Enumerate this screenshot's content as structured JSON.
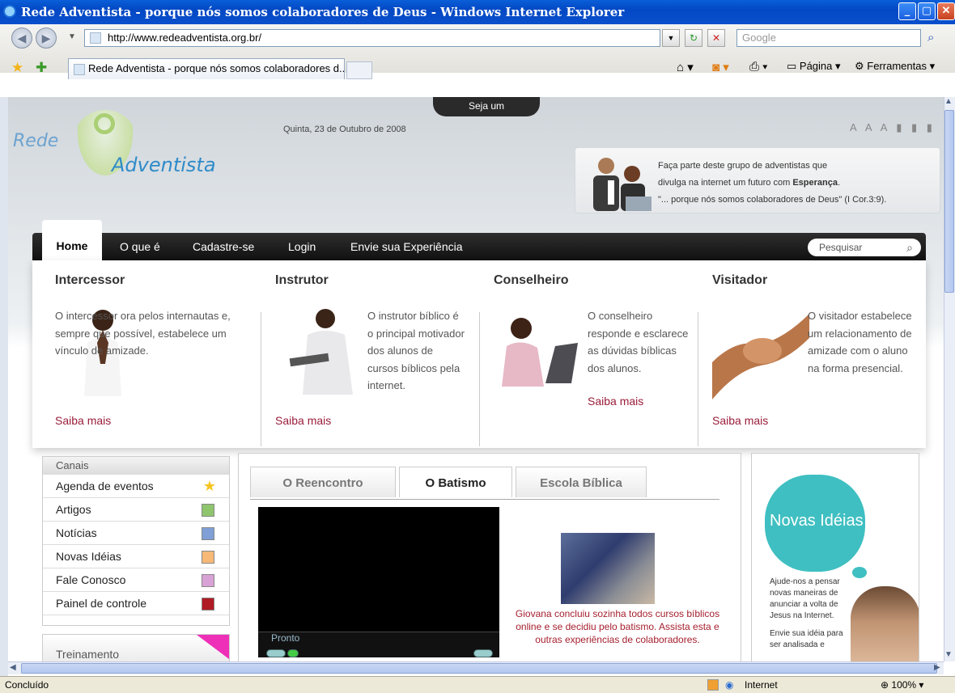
{
  "window": {
    "title": "Rede Adventista - porque nós somos colaboradores de Deus - Windows Internet Explorer",
    "url": "http://www.redeadventista.org.br/",
    "search_placeholder": "Google",
    "tab_label": "Rede Adventista - porque nós somos colaboradores d...",
    "cmd_page": "Página",
    "cmd_tools": "Ferramentas"
  },
  "header": {
    "seja_um": "Seja um",
    "logo_line1": "Rede",
    "logo_line2": "Adventista",
    "date": "Quinta, 23 de Outubro de 2008",
    "font_controls": "A A A",
    "promo_line1": "Faça parte deste grupo de adventistas que",
    "promo_line2_pre": "divulga na internet um futuro com ",
    "promo_line2_bold": "Esperança",
    "promo_line2_post": ".",
    "promo_line3": "\"... porque nós somos colaboradores de Deus\" (I Cor.3:9)."
  },
  "nav": {
    "items": [
      "Home",
      "O que é",
      "Cadastre-se",
      "Login",
      "Envie sua Experiência"
    ],
    "search_placeholder": "Pesquisar"
  },
  "roles": [
    {
      "title": "Intercessor",
      "desc": "O intercessor ora pelos internautas e, sempre que possível, estabelece um vínculo de amizade.",
      "more": "Saiba mais"
    },
    {
      "title": "Instrutor",
      "desc": "O instrutor bíblico é o principal motivador dos alunos de cursos bíblicos pela internet.",
      "more": "Saiba mais"
    },
    {
      "title": "Conselheiro",
      "desc": "O conselheiro responde e esclarece as dúvidas bíblicas dos alunos.",
      "more": "Saiba mais"
    },
    {
      "title": "Visitador",
      "desc": "O visitador estabelece um relacionamento de amizade com o aluno na forma presencial.",
      "more": "Saiba mais"
    }
  ],
  "canais": {
    "header": "Canais",
    "items": [
      "Agenda de eventos",
      "Artigos",
      "Notícias",
      "Novas Idéias",
      "Fale Conosco",
      "Painel de controle"
    ],
    "colors": [
      "#f6c420",
      "#8fc56d",
      "#7f9fd6",
      "#f7b878",
      "#d9a2d6",
      "#b01c24"
    ]
  },
  "treinamento": "Treinamento",
  "center": {
    "tabs": [
      "O Reencontro",
      "O Batismo",
      "Escola Bíblica"
    ],
    "active_tab": "O Batismo",
    "video_status": "Pronto",
    "caption": "Giovana concluiu sozinha todos cursos bíblicos online e se decidiu pelo batismo. Assista esta e outras experiências de colaboradores."
  },
  "right": {
    "bubble": "Novas Idéias",
    "text1": "Ajude-nos a pensar novas maneiras de anunciar a volta de Jesus na Internet.",
    "text2": "Envie sua idéia para ser analisada e"
  },
  "status": {
    "left": "Concluído",
    "zone": "Internet",
    "zoom": "100%"
  }
}
